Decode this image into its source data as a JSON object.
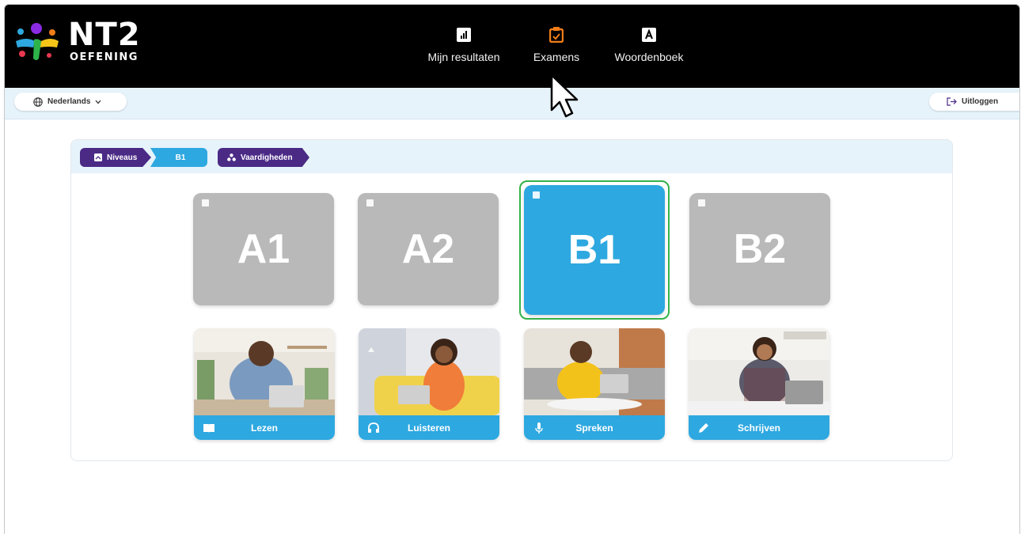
{
  "brand": {
    "name": "NT2",
    "subtitle": "OEFENING"
  },
  "nav": [
    {
      "label": "Mijn resultaten",
      "icon": "chart-icon"
    },
    {
      "label": "Examens",
      "icon": "exam-icon",
      "accent": "#f07d1a"
    },
    {
      "label": "Woordenboek",
      "icon": "dictionary-icon"
    }
  ],
  "toolbar": {
    "language": "Nederlands",
    "logout": "Uitloggen"
  },
  "breadcrumb": {
    "niveaus": "Niveaus",
    "current": "B1",
    "vaardigheden": "Vaardigheden"
  },
  "levels": [
    {
      "label": "A1",
      "active": false
    },
    {
      "label": "A2",
      "active": false
    },
    {
      "label": "B1",
      "active": true
    },
    {
      "label": "B2",
      "active": false
    }
  ],
  "skills": [
    {
      "label": "Lezen",
      "icon": "book-icon"
    },
    {
      "label": "Luisteren",
      "icon": "headphones-icon"
    },
    {
      "label": "Spreken",
      "icon": "microphone-icon"
    },
    {
      "label": "Schrijven",
      "icon": "pencil-icon"
    }
  ],
  "colors": {
    "accent_blue": "#2ea8e0",
    "purple": "#4b2a86",
    "inactive_gray": "#b9b9b9",
    "active_border": "#34b24a",
    "header_bg": "#000000"
  }
}
